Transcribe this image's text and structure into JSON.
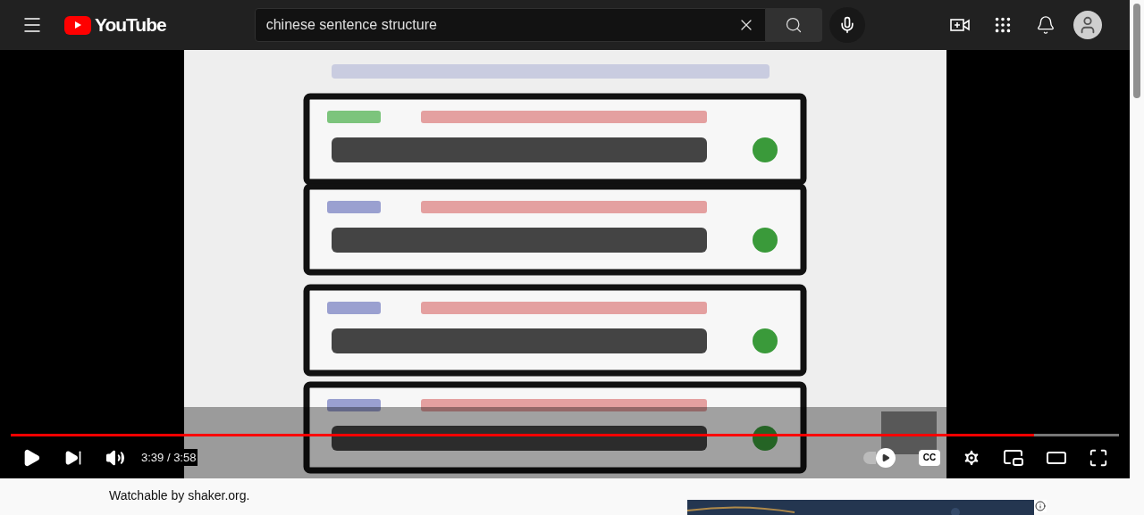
{
  "header": {
    "logo_text": "YouTube",
    "search": {
      "value": "chinese sentence structure"
    }
  },
  "player": {
    "progress": {
      "level": 0.923
    },
    "time": "3:39 / 3:58",
    "autoplay": {
      "on": true
    },
    "captions_label": "CC"
  },
  "below": {
    "license_text": "Watchable by shaker.org."
  }
}
